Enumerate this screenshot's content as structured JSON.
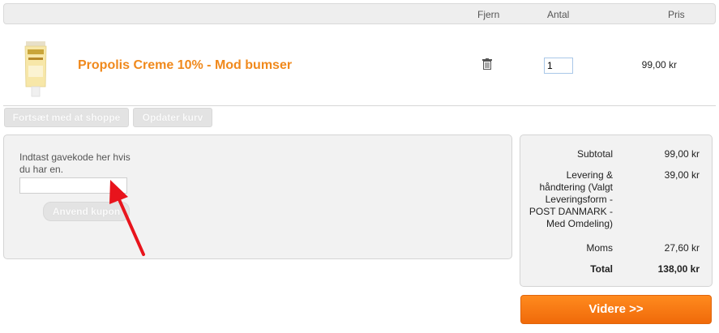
{
  "header": {
    "remove_col": "Fjern",
    "qty_col": "Antal",
    "price_col": "Pris"
  },
  "product": {
    "name": "Propolis Creme 10% - Mod bumser",
    "quantity": "1",
    "price": "99,00 kr",
    "thumbnail_icon": "cream-tube-icon",
    "remove_icon": "trash-icon"
  },
  "actions": {
    "continue_shopping": "Fortsæt med at shoppe",
    "update_cart": "Opdater kurv"
  },
  "coupon": {
    "label": "Indtast gavekode her hvis du har en.",
    "input_value": "",
    "apply_button": "Anvend kupon"
  },
  "summary": {
    "subtotal_label": "Subtotal",
    "subtotal_value": "99,00 kr",
    "shipping_label": "Levering & håndtering (Valgt Leveringsform - POST DANMARK - Med Omdeling)",
    "shipping_value": "39,00 kr",
    "tax_label": "Moms",
    "tax_value": "27,60 kr",
    "total_label": "Total",
    "total_value": "138,00 kr"
  },
  "checkout_button": "Videre >>",
  "colors": {
    "accent_orange": "#f0891c",
    "button_orange": "#f27614",
    "annotation_red": "#e8141c"
  }
}
